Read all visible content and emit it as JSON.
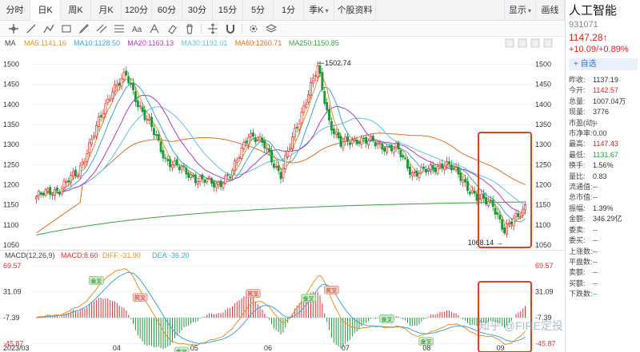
{
  "tabs": [
    {
      "label": "分时",
      "w": 38
    },
    {
      "label": "日K",
      "w": 38,
      "active": true
    },
    {
      "label": "周K",
      "w": 38
    },
    {
      "label": "月K",
      "w": 38
    },
    {
      "label": "120分",
      "w": 38
    },
    {
      "label": "60分",
      "w": 38
    },
    {
      "label": "30分",
      "w": 38
    },
    {
      "label": "15分",
      "w": 38
    },
    {
      "label": "5分",
      "w": 38
    },
    {
      "label": "1分",
      "w": 38
    },
    {
      "label": "季K",
      "w": 38,
      "caret": true
    },
    {
      "label": "个股资料",
      "w": 52
    }
  ],
  "tabs_right": [
    {
      "label": "显示",
      "w": 40,
      "caret": true
    },
    {
      "label": "画线",
      "w": 36
    }
  ],
  "tools": [
    "crosshair-icon",
    "line-icon",
    "polyline-icon",
    "rect-icon",
    "pencil-icon",
    "channel-icon",
    "fib-icon",
    "text-icon",
    "fork-icon",
    "eraser-icon",
    "trash-icon",
    "move-icon",
    "magnet-icon",
    "settings-icon",
    "layers-icon"
  ],
  "ma_legend": {
    "label": "MA",
    "items": [
      {
        "text": "MA5:1141.16",
        "color": "#e8921c"
      },
      {
        "text": "MA10:1128.50",
        "color": "#3aa6dc"
      },
      {
        "text": "MA20:1163.13",
        "color": "#b23ac8"
      },
      {
        "text": "MA30:1192.01",
        "color": "#5fc0e8"
      },
      {
        "text": "MA60:1260.71",
        "color": "#e07020"
      },
      {
        "text": "MA250:1150.85",
        "color": "#3aa040"
      }
    ]
  },
  "macd_legend": {
    "label": "MACD(12,26,9)",
    "items": [
      {
        "text": "MACD:8.60",
        "color": "#e03030"
      },
      {
        "text": "DIFF:-31.90",
        "color": "#e8921c"
      },
      {
        "text": "DEA:-36.20",
        "color": "#3aa6dc"
      }
    ]
  },
  "price_axis": [
    "1500",
    "1450",
    "1400",
    "1350",
    "1300",
    "1250",
    "1200",
    "1150",
    "1100",
    "1050"
  ],
  "macd_axis_left": [
    "69.57",
    "31.09",
    "-7.39",
    "-45.87"
  ],
  "macd_axis_right": [
    "69.57",
    "31.09",
    "-7.39",
    "-45.87"
  ],
  "dates": [
    "2023/03",
    "04",
    "05",
    "06",
    "07",
    "08",
    "09"
  ],
  "annotations": {
    "high": "1502.74",
    "low": "1068.14"
  },
  "signals": [
    "金叉",
    "死叉",
    "金叉",
    "死叉",
    "金叉",
    "死叉",
    "金叉",
    "金叉"
  ],
  "colors": {
    "up": "#e03030",
    "down": "#1a9a3a",
    "highlight": "#e04020",
    "grid": "#eef0f3"
  },
  "watermark": "知乎 @FIRE定投",
  "panel": {
    "name": "人工智能",
    "code": "931071",
    "price": "1147.28",
    "price_arrow": "↑",
    "change": "+10.09/+0.89%",
    "watch": "+ 自选",
    "stats": [
      {
        "k": "昨收",
        "v": "1137.19"
      },
      {
        "k": "今开",
        "v": "1142.57",
        "c": "up"
      },
      {
        "k": "总量",
        "v": "1007.04万"
      },
      {
        "k": "现量",
        "v": "3776"
      },
      {
        "k": "市盈(动)",
        "v": "--"
      },
      {
        "k": "市净率",
        "v": "0.00"
      },
      {
        "k": "最高",
        "v": "1147.43",
        "c": "up"
      },
      {
        "k": "最低",
        "v": "1131.67",
        "c": "down"
      },
      {
        "k": "换手",
        "v": "1.56%"
      },
      {
        "k": "量比",
        "v": "0.83"
      },
      {
        "k": "流通值",
        "v": "--"
      },
      {
        "k": "总市值",
        "v": "--"
      },
      {
        "k": "振幅",
        "v": "1.39%"
      },
      {
        "k": "金额",
        "v": "346.29亿"
      },
      {
        "k": "委卖",
        "v": "--"
      },
      {
        "k": "委买",
        "v": "--"
      },
      {
        "k": "上涨数",
        "v": "--"
      },
      {
        "k": "平盘数",
        "v": "--"
      },
      {
        "k": "卖额",
        "v": "--"
      },
      {
        "k": "买额",
        "v": "--"
      },
      {
        "k": "下跌数",
        "v": "--",
        "c": "down"
      }
    ]
  }
}
